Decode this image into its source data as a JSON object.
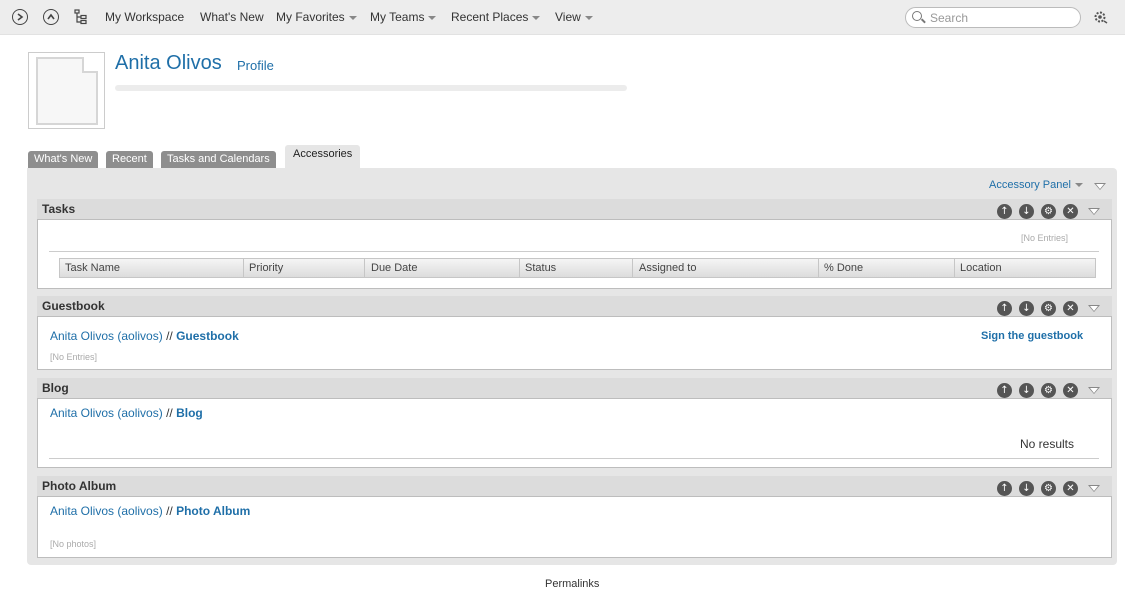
{
  "nav": {
    "items": [
      "My Workspace",
      "What's New",
      "My Favorites",
      "My Teams",
      "Recent Places",
      "View"
    ],
    "search_placeholder": "Search"
  },
  "profile": {
    "name": "Anita Olivos",
    "profile_link": "Profile"
  },
  "tabs": [
    "What's New",
    "Recent",
    "Tasks and Calendars",
    "Accessories"
  ],
  "active_tab": "Accessories",
  "panel": {
    "accessory_panel_label": "Accessory Panel"
  },
  "tasks": {
    "title": "Tasks",
    "no_entries": "[No Entries]",
    "columns": [
      "Task Name",
      "Priority",
      "Due Date",
      "Status",
      "Assigned to",
      "% Done",
      "Location"
    ]
  },
  "guestbook": {
    "title": "Guestbook",
    "owner_link": "Anita Olivos (aolivos)",
    "separator": "//",
    "name_link": "Guestbook",
    "sign_link": "Sign the guestbook",
    "no_entries": "[No Entries]"
  },
  "blog": {
    "title": "Blog",
    "owner_link": "Anita Olivos (aolivos)",
    "separator": "//",
    "name_link": "Blog",
    "no_results": "No results"
  },
  "photo_album": {
    "title": "Photo Album",
    "owner_link": "Anita Olivos (aolivos)",
    "separator": "//",
    "name_link": "Photo Album",
    "no_photos": "[No photos]"
  },
  "footer": {
    "permalinks": "Permalinks"
  }
}
